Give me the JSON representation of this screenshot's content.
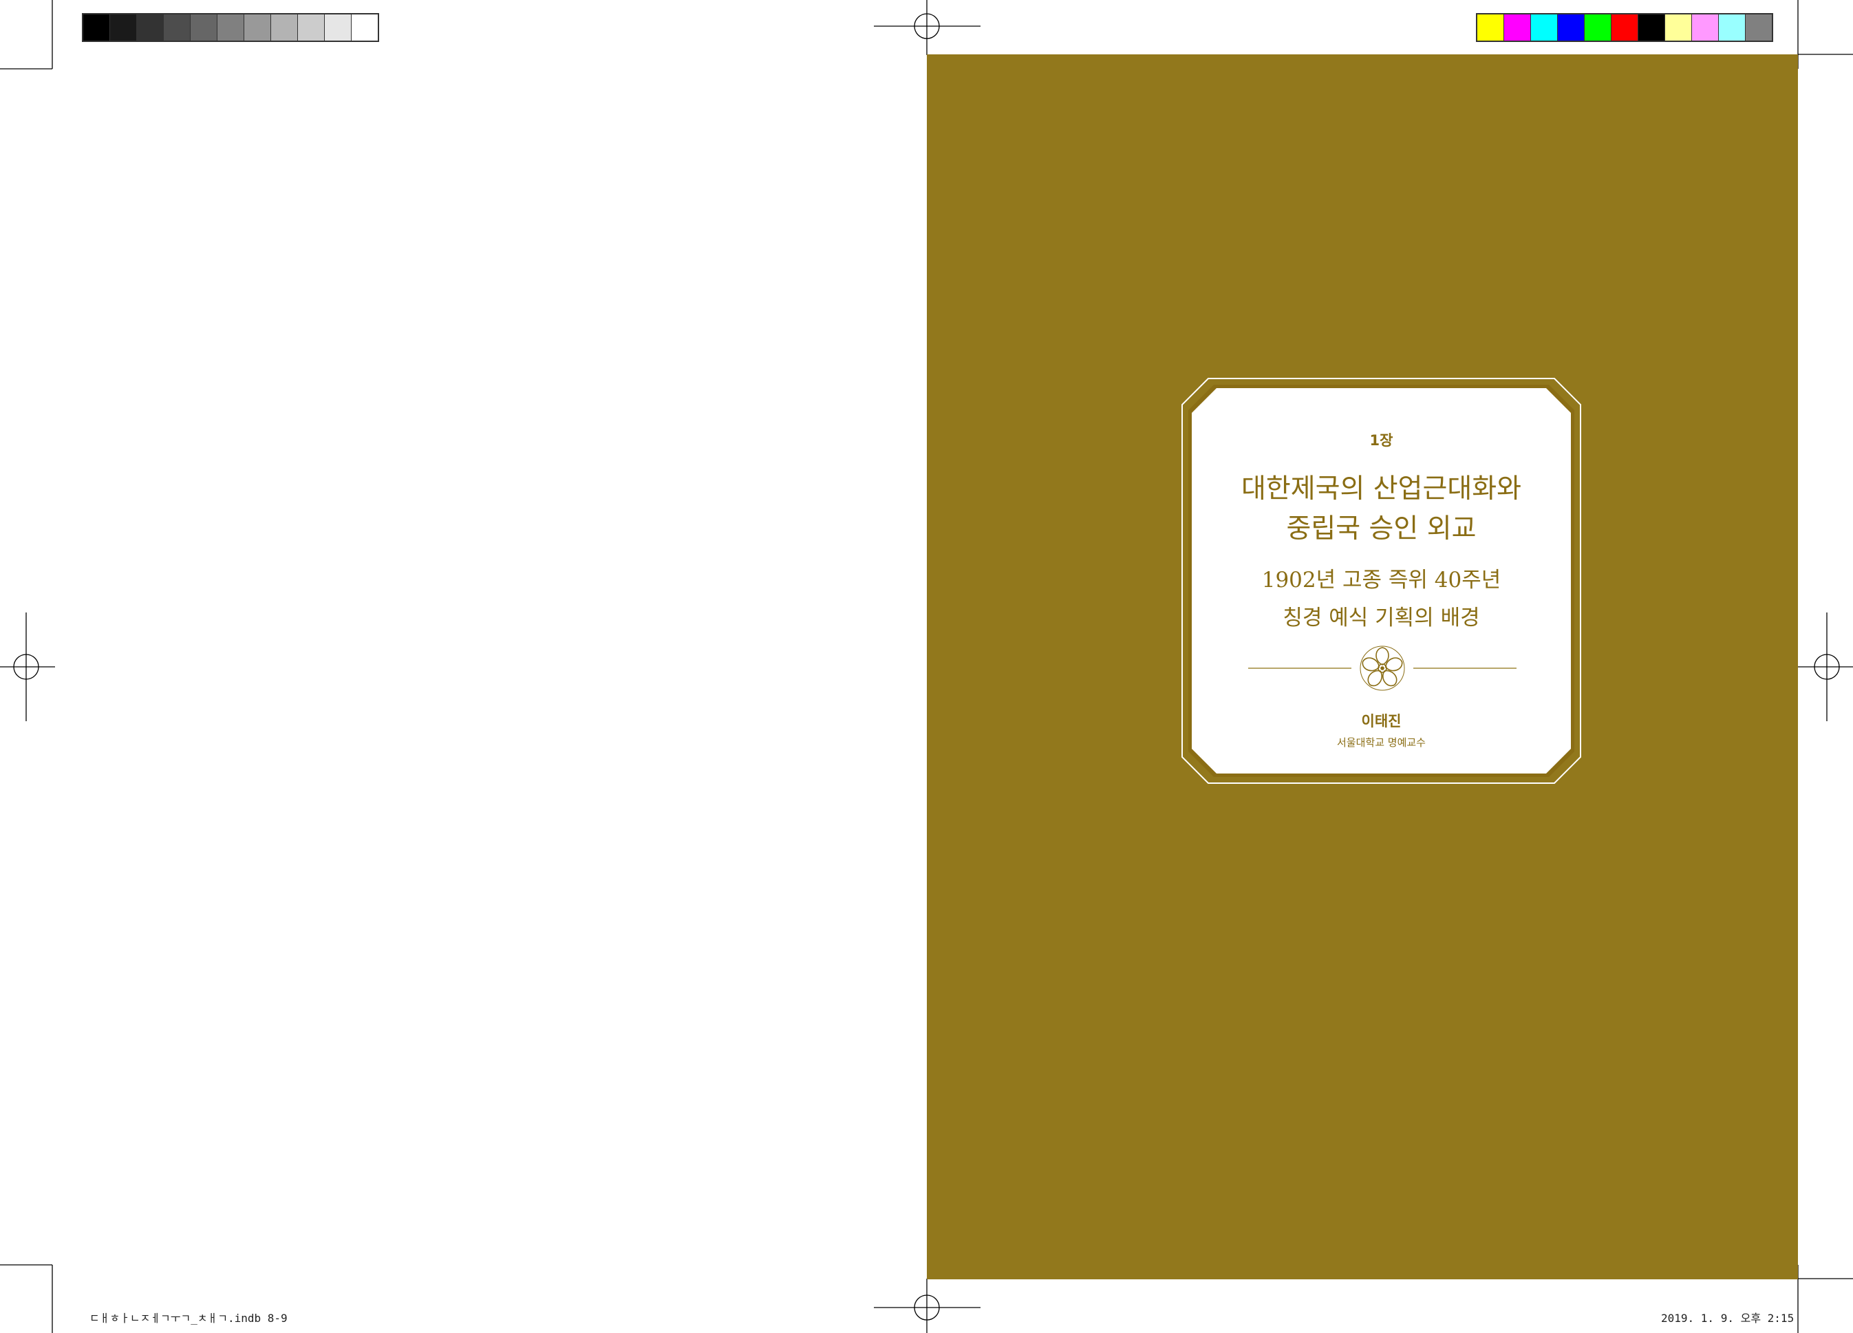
{
  "colors": {
    "cover": "#92781c",
    "gold": "#8a6d14",
    "frame_fill": "#ffffff"
  },
  "gray_swatches": [
    "#000000",
    "#1a1a1a",
    "#333333",
    "#4d4d4d",
    "#666666",
    "#808080",
    "#999999",
    "#b3b3b3",
    "#cccccc",
    "#e6e6e6",
    "#ffffff"
  ],
  "color_swatches": [
    "#ffff00",
    "#ff00ff",
    "#00ffff",
    "#0000ff",
    "#00ff00",
    "#ff0000",
    "#000000",
    "#ffff99",
    "#ff99ff",
    "#99ffff",
    "#808080"
  ],
  "cover": {
    "chapter": "1장",
    "title_line1": "대한제국의 산업근대화와",
    "title_line2": "중립국 승인 외교",
    "subtitle_line1": "1902년 고종 즉위 40주년",
    "subtitle_line2": "칭경 예식 기획의 배경",
    "author": "이태진",
    "affiliation": "서울대학교 명예교수",
    "ornament_icon": "plum-blossom-icon"
  },
  "slug": {
    "file_name": "ㄷㅐㅎㅏㄴㅈㅔㄱㅜㄱ_ㅊㅐㄱ.indb   8-9",
    "timestamp": "2019. 1. 9.   오후 2:15"
  }
}
